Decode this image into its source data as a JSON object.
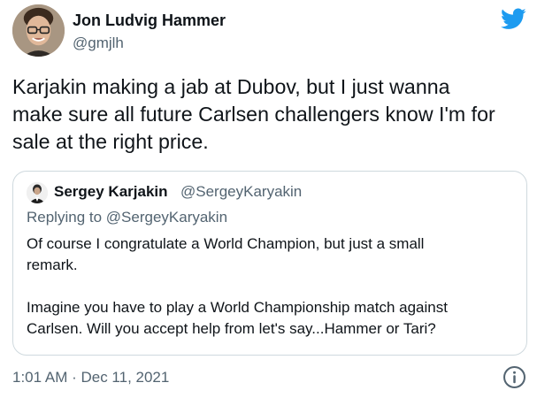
{
  "author": {
    "name": "Jon Ludvig Hammer",
    "handle": "@gmjlh",
    "avatar_icon": "profile-photo"
  },
  "tweet": {
    "text": "Karjakin making a jab at Dubov, but I just wanna\nmake sure all future Carlsen challengers know I'm for\nsale at the right price."
  },
  "quoted_tweet": {
    "name": "Sergey Karjakin",
    "handle": "@SergeyKaryakin",
    "replying_prefix": "Replying to ",
    "replying_to": "@SergeyKaryakin",
    "text": "Of course I congratulate a World Champion, but just a small\nremark.\n\nImagine you have to play a World Championship match against\nCarlsen. Will you accept help from let's say...Hammer or Tari?"
  },
  "footer": {
    "timestamp": "1:01 AM · Dec 11, 2021"
  },
  "icons": {
    "brand": "twitter-bird-icon",
    "info": "info-icon"
  },
  "colors": {
    "twitter_blue": "#1d9bf0",
    "text_primary": "#0f1419",
    "text_secondary": "#536471",
    "border": "#cfd9de"
  }
}
